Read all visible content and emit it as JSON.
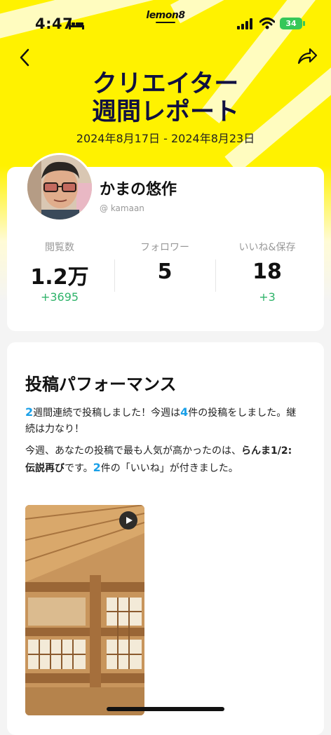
{
  "status_bar": {
    "time": "4:47",
    "battery": "34"
  },
  "app": {
    "brand": "lemon8"
  },
  "header": {
    "title_line1": "クリエイター",
    "title_line2": "週間レポート",
    "date_range": "2024年8月17日 - 2024年8月23日"
  },
  "profile": {
    "name": "かまの悠作",
    "handle": "@ kamaan",
    "stats": [
      {
        "label": "閲覧数",
        "value": "1.2万",
        "delta": "+3695"
      },
      {
        "label": "フォロワー",
        "value": "5",
        "delta": ""
      },
      {
        "label": "いいね&保存",
        "value": "18",
        "delta": "+3"
      }
    ]
  },
  "performance": {
    "title": "投稿パフォーマンス",
    "p1": {
      "n1": "2",
      "t1": "週間連続で投稿しました！今週は",
      "n2": "4",
      "t2": "件の投稿をしました。継続は力なり！"
    },
    "p2": {
      "t1": "今週、あなたの投稿で最も人気が高かったのは、",
      "post_title": "らんま1/2: 伝説再び",
      "t2": "です。",
      "n": "2",
      "t3": "件の「いいね」が付きました。"
    }
  },
  "icons": {
    "back": "chevron-left-icon",
    "share": "share-arrow-icon",
    "play": "play-icon",
    "bed": "bed-icon",
    "signal": "cellular-signal-icon",
    "wifi": "wifi-icon"
  },
  "colors": {
    "accent_yellow": "#fff200",
    "highlight_blue": "#1aa0e8",
    "delta_green": "#2fb36a",
    "title_navy": "#101040"
  }
}
